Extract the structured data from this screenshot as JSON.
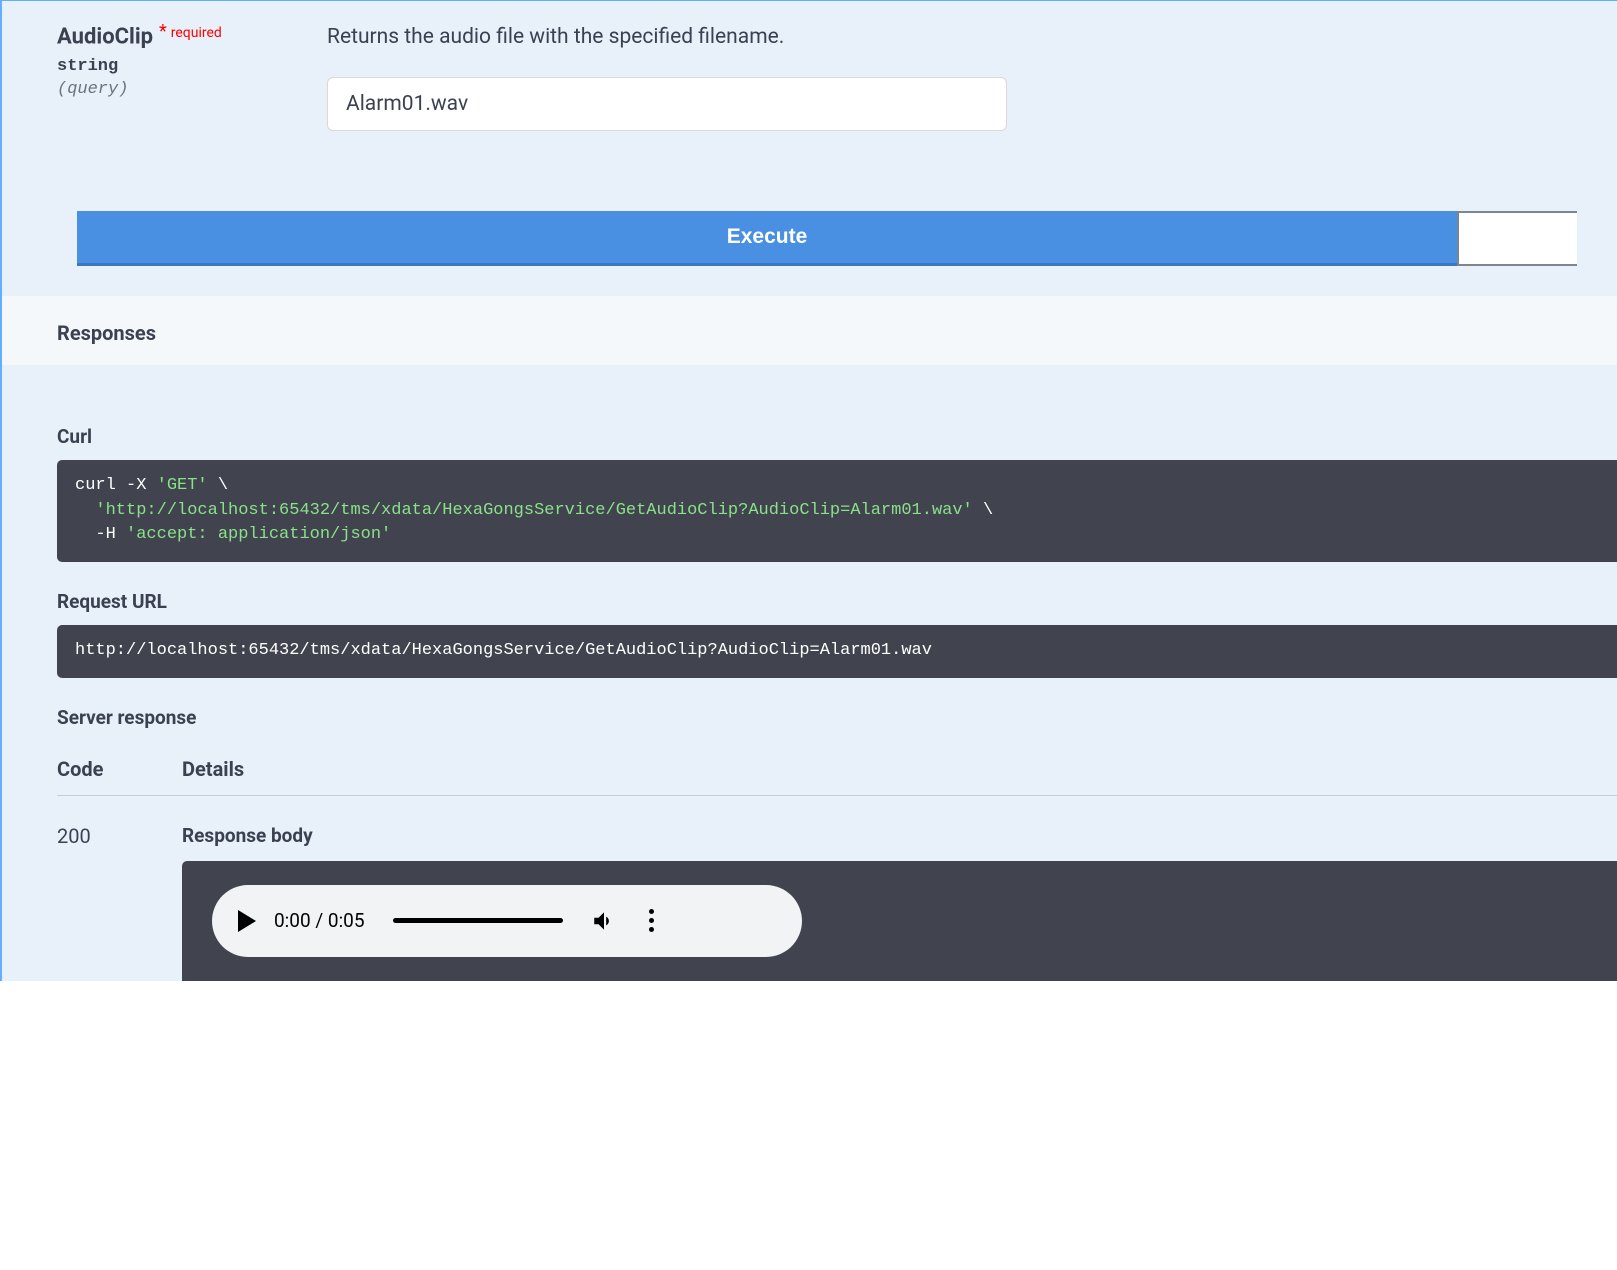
{
  "param": {
    "name": "AudioClip",
    "required_star": "*",
    "required_text": "required",
    "type": "string",
    "in": "(query)",
    "description": "Returns the audio file with the specified filename.",
    "value": "Alarm01.wav"
  },
  "buttons": {
    "execute": "Execute"
  },
  "responses": {
    "heading": "Responses",
    "curl_label": "Curl",
    "curl_prefix": "curl -X ",
    "curl_method": "'GET'",
    "curl_backslash": " \\",
    "curl_url": "'http://localhost:65432/tms/xdata/HexaGongsService/GetAudioClip?AudioClip=Alarm01.wav'",
    "curl_header_flag": "  -H ",
    "curl_header_val": "'accept: application/json'",
    "request_url_label": "Request URL",
    "request_url": "http://localhost:65432/tms/xdata/HexaGongsService/GetAudioClip?AudioClip=Alarm01.wav",
    "server_response_label": "Server response",
    "code_header": "Code",
    "details_header": "Details",
    "code_value": "200",
    "response_body_label": "Response body",
    "audio": {
      "time": "0:00 / 0:05"
    }
  }
}
